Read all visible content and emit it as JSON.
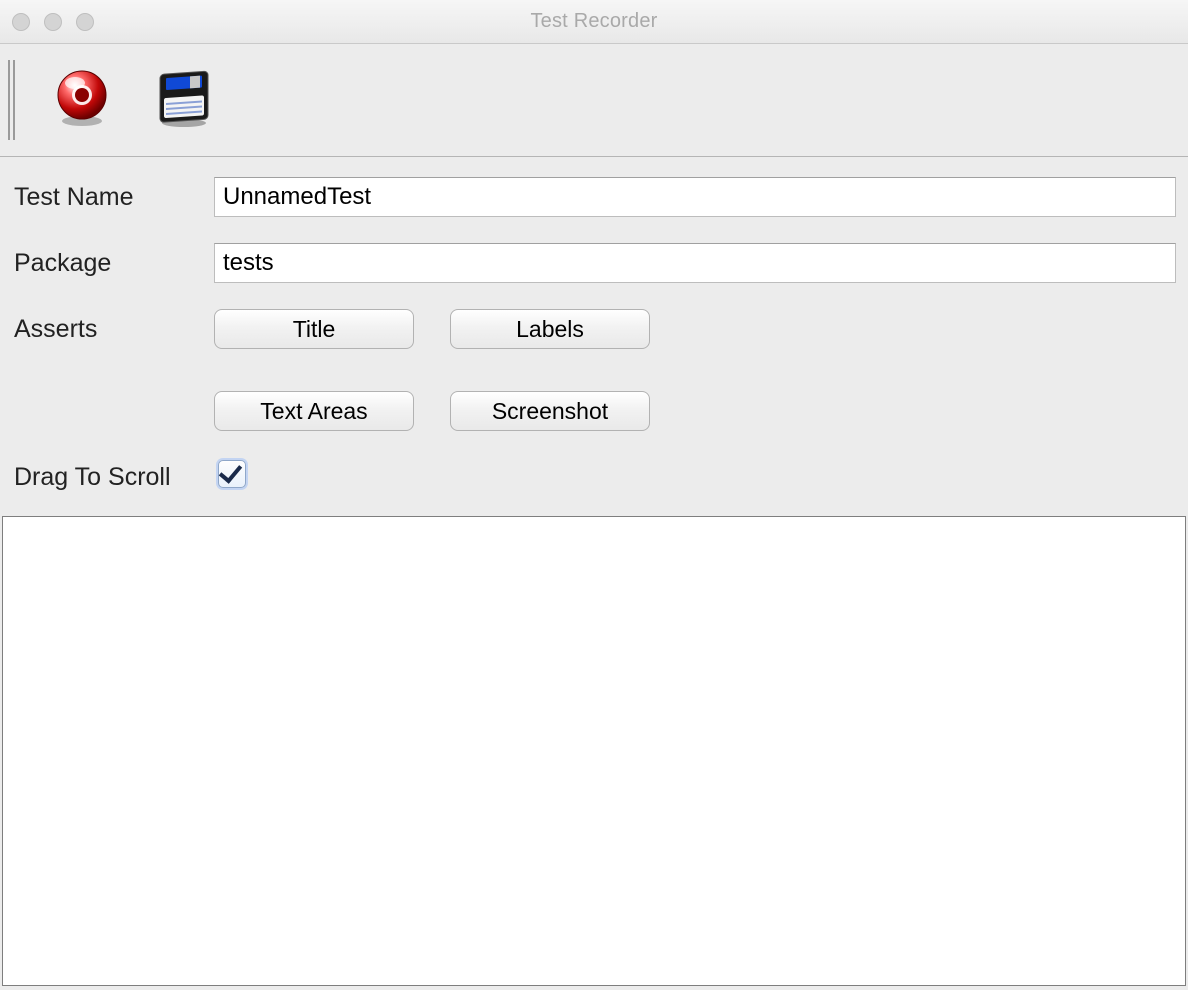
{
  "window": {
    "title": "Test Recorder"
  },
  "toolbar": {
    "record_icon": "record-icon",
    "save_icon": "save-icon"
  },
  "form": {
    "test_name_label": "Test Name",
    "test_name_value": "UnnamedTest",
    "package_label": "Package",
    "package_value": "tests",
    "asserts_label": "Asserts",
    "asserts_buttons": {
      "title": "Title",
      "labels": "Labels",
      "text_areas": "Text Areas",
      "screenshot": "Screenshot"
    },
    "drag_to_scroll_label": "Drag To Scroll",
    "drag_to_scroll_checked": true
  }
}
